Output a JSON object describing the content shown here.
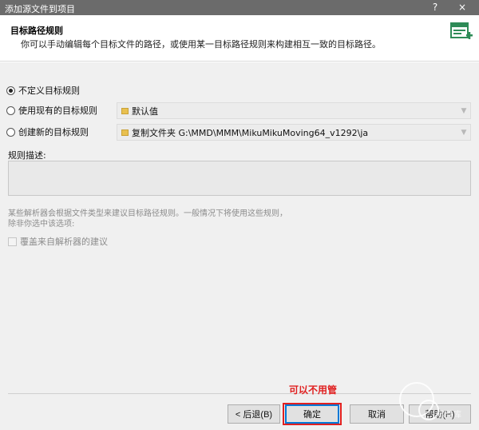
{
  "window": {
    "title": "添加源文件到项目",
    "help_label": "?",
    "close_label": "×"
  },
  "header": {
    "title": "目标路径规则",
    "description": "你可以手动编辑每个目标文件的路径，或使用某一目标路径规则来构建相互一致的目标路径。",
    "icon": "grid-add-icon",
    "icon_color": "#2e8b57"
  },
  "options": [
    {
      "label": "不定义目标规则",
      "checked": true
    },
    {
      "label": "使用现有的目标规则",
      "checked": false
    },
    {
      "label": "创建新的目标规则",
      "checked": false
    }
  ],
  "existing_rule": {
    "value": "默认值"
  },
  "new_rule": {
    "value": "复制文件夹 G:\\MMD\\MMM\\MikuMikuMoving64_v1292\\ja"
  },
  "rule_description": {
    "label": "规则描述:",
    "value": ""
  },
  "note": {
    "line1": "某些解析器会根据文件类型来建议目标路径规则。一般情况下将使用这些规则，",
    "line2": "除非你选中该选项:"
  },
  "override_checkbox": {
    "label": "覆盖来自解析器的建议",
    "checked": false
  },
  "annotation": {
    "text": "可以不用管",
    "color": "#e02020"
  },
  "buttons": {
    "back": "< 后退(B)",
    "ok": "确定",
    "cancel": "取消",
    "help": "帮助(H)"
  },
  "watermark": {
    "text": "软件库"
  }
}
